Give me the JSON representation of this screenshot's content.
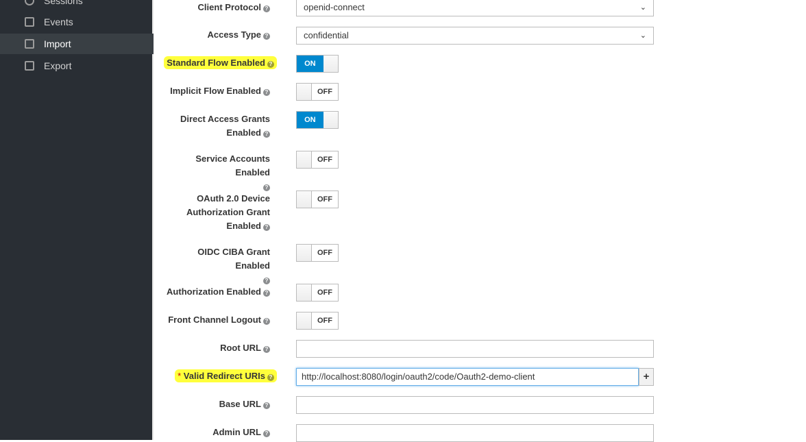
{
  "sidebar": {
    "items": [
      {
        "label": "Sessions",
        "icon": "clock-icon",
        "active": false
      },
      {
        "label": "Events",
        "icon": "calendar-icon",
        "active": false
      },
      {
        "label": "Import",
        "icon": "import-icon",
        "active": true
      },
      {
        "label": "Export",
        "icon": "export-icon",
        "active": false
      }
    ]
  },
  "form": {
    "client_protocol": {
      "label": "Client Protocol",
      "value": "openid-connect"
    },
    "access_type": {
      "label": "Access Type",
      "value": "confidential"
    },
    "standard_flow": {
      "label": "Standard Flow Enabled",
      "state": "ON"
    },
    "implicit_flow": {
      "label": "Implicit Flow Enabled",
      "state": "OFF"
    },
    "direct_access": {
      "label": "Direct Access Grants Enabled",
      "state": "ON"
    },
    "service_accounts": {
      "label": "Service Accounts Enabled",
      "state": "OFF"
    },
    "device_grant": {
      "label": "OAuth 2.0 Device Authorization Grant Enabled",
      "state": "OFF"
    },
    "ciba": {
      "label": "OIDC CIBA Grant Enabled",
      "state": "OFF"
    },
    "authorization": {
      "label": "Authorization Enabled",
      "state": "OFF"
    },
    "front_channel": {
      "label": "Front Channel Logout",
      "state": "OFF"
    },
    "root_url": {
      "label": "Root URL",
      "value": ""
    },
    "redirect_uris": {
      "required": "*",
      "label": "Valid Redirect URIs",
      "value": "http://localhost:8080/login/oauth2/code/Oauth2-demo-client",
      "add": "+"
    },
    "base_url": {
      "label": "Base URL",
      "value": ""
    },
    "admin_url": {
      "label": "Admin URL",
      "value": ""
    }
  },
  "colors": {
    "accent": "#0088ce",
    "sidebar": "#292e34",
    "highlight": "#ffff3c"
  }
}
